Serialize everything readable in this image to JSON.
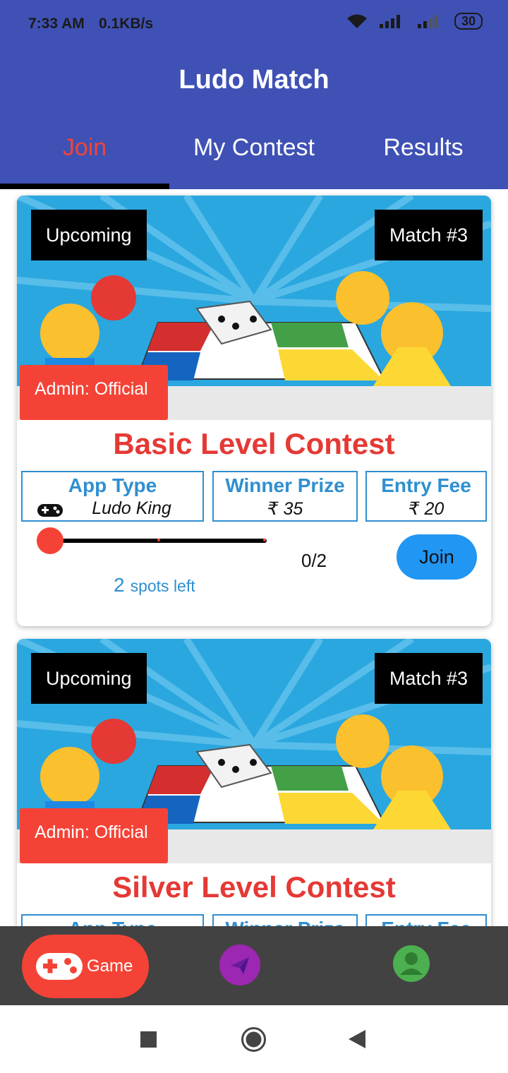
{
  "status_bar": {
    "time": "7:33 AM",
    "network_speed": "0.1KB/s",
    "battery": "30"
  },
  "app": {
    "title": "Ludo Match",
    "tabs": [
      "Join",
      "My Contest",
      "Results"
    ],
    "active_tab": "Join"
  },
  "cards": [
    {
      "status": "Upcoming",
      "match": "Match #3",
      "admin": "Admin: Official",
      "title": "Basic Level Contest",
      "app_type_label": "App Type",
      "app_type_value": "Ludo King",
      "prize_label": "Winner Prize",
      "prize_value": "₹ 35",
      "fee_label": "Entry Fee",
      "fee_value": "₹ 20",
      "joined": "0/2",
      "join_label": "Join",
      "spots_count": "2",
      "spots_label": "spots left",
      "fill_fraction": 0
    },
    {
      "status": "Upcoming",
      "match": "Match #3",
      "admin": "Admin: Official",
      "title": "Silver Level Contest",
      "app_type_label": "App Type",
      "prize_label": "Winner Prize",
      "fee_label": "Entry Fee"
    }
  ],
  "bottom_nav": {
    "game_label": "Game",
    "items": [
      "gamepad-icon",
      "send-icon",
      "account-icon"
    ]
  },
  "colors": {
    "primary": "#3f51b5",
    "accent": "#f44336",
    "blue": "#2196f3",
    "info_blue": "#2f8fd1",
    "nav_bg": "#424242",
    "purple": "#9c27b0",
    "green": "#4caf50"
  }
}
